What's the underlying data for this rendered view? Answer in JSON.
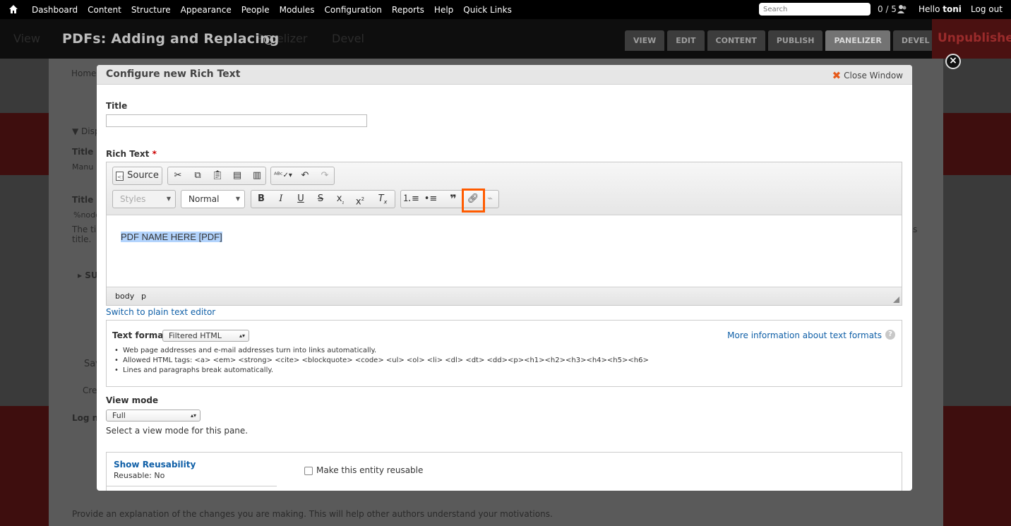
{
  "toolbar": {
    "menu": [
      "Dashboard",
      "Content",
      "Structure",
      "Appearance",
      "People",
      "Modules",
      "Configuration",
      "Reports",
      "Help",
      "Quick Links"
    ],
    "search_placeholder": "Search",
    "count": "0 / 5",
    "hello_prefix": "Hello",
    "user": "toni",
    "logout": "Log out"
  },
  "page": {
    "title": "PDFs: Adding and Replacing",
    "ghost_tabs": [
      "View",
      "Panelizer",
      "Devel"
    ],
    "tabs": [
      {
        "label": "VIEW",
        "active": false
      },
      {
        "label": "EDIT",
        "active": false
      },
      {
        "label": "CONTENT",
        "active": false
      },
      {
        "label": "PUBLISH",
        "active": false
      },
      {
        "label": "PANELIZER",
        "active": true
      },
      {
        "label": "DEVEL",
        "active": false
      }
    ],
    "status": "Unpublished",
    "behind": {
      "home": "Home",
      "disp": "Disp",
      "title1": "Title",
      "manu": "Manu",
      "title2": "Title",
      "node": "%node",
      "the_ti": "The ti",
      "title_dot": "title.",
      "su": "SU",
      "s": "s",
      "sav": "Sav",
      "cre": "Cre",
      "log": "Log n",
      "bottom": "Provide an explanation of the changes you are making. This will help other authors understand your motivations."
    }
  },
  "modal": {
    "title": "Configure new Rich Text",
    "close_label": "Close Window",
    "title_field_label": "Title",
    "title_value": "",
    "rich_text_label": "Rich Text",
    "required_mark": "*",
    "editor": {
      "source_label": "Source",
      "styles_label": "Styles",
      "format_label": "Normal",
      "content": "PDF NAME HERE [PDF]",
      "path": [
        "body",
        "p"
      ]
    },
    "switch_label": "Switch to plain text editor",
    "text_format": {
      "label": "Text format",
      "selected": "Filtered HTML",
      "more_info": "More information about text formats",
      "tips": [
        "Web page addresses and e-mail addresses turn into links automatically.",
        "Allowed HTML tags: <a> <em> <strong> <cite> <blockquote> <code> <ul> <ol> <li> <dl> <dt> <dd><p><h1><h2><h3><h4><h5><h6>",
        "Lines and paragraphs break automatically."
      ]
    },
    "view_mode": {
      "label": "View mode",
      "selected": "Full",
      "description": "Select a view mode for this pane."
    },
    "reusability": {
      "title": "Show Reusability",
      "status": "Reusable: No",
      "checkbox_label": "Make this entity reusable",
      "checked": false
    }
  },
  "colors": {
    "highlight": "#ff5b00",
    "link": "#0f5fa7",
    "selection": "#b3d4fd"
  }
}
